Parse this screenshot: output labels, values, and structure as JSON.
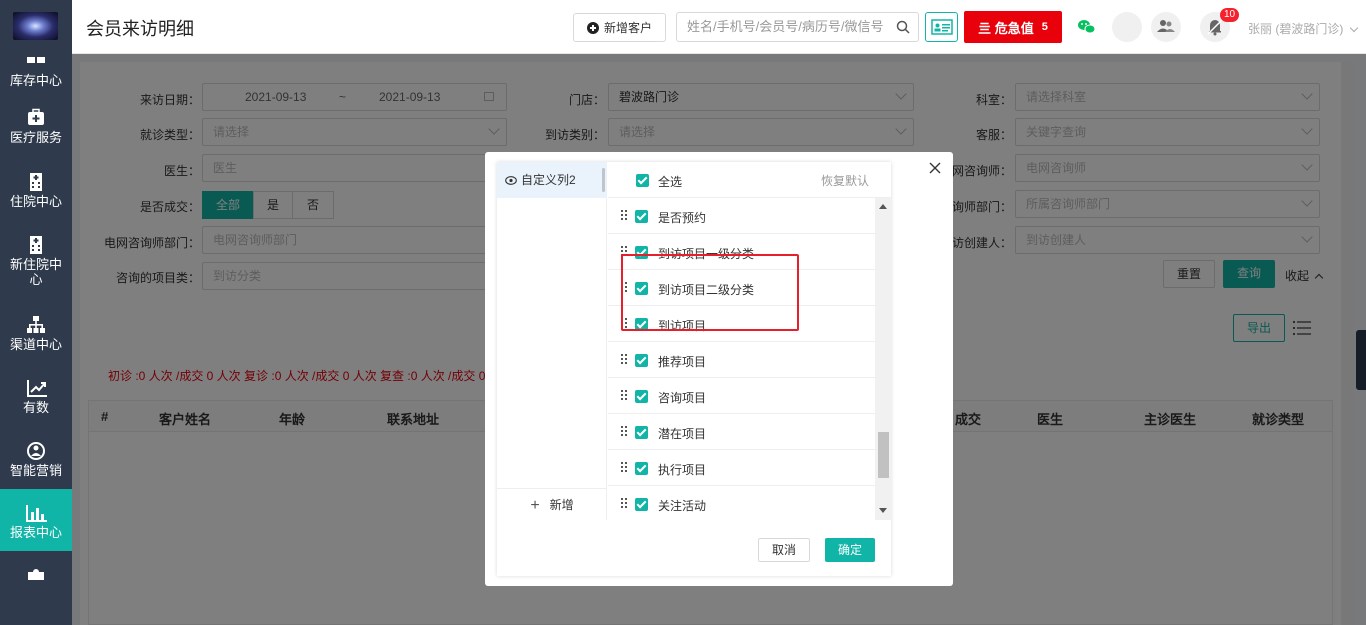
{
  "sidebar": {
    "items": [
      {
        "label": "库存中心",
        "icon": "inventory-icon"
      },
      {
        "label": "医疗服务",
        "icon": "medical-kit-icon"
      },
      {
        "label": "住院中心",
        "icon": "hospital-icon"
      },
      {
        "label": "新住院中心",
        "icon": "hospital-building-icon"
      },
      {
        "label": "渠道中心",
        "icon": "org-chart-icon"
      },
      {
        "label": "有数",
        "icon": "trend-chart-icon"
      },
      {
        "label": "智能营销",
        "icon": "marketing-icon"
      },
      {
        "label": "报表中心",
        "icon": "bar-chart-icon"
      }
    ]
  },
  "header": {
    "title": "会员来访明细",
    "new_customer": "新增客户",
    "search_placeholder": "姓名/手机号/会员号/病历号/微信号",
    "urgent_label": "危急值",
    "urgent_count": "5",
    "notif_count": "10",
    "user": "张丽 (碧波路门诊)"
  },
  "filters": {
    "visit_date_label": "来访日期：",
    "date_start": "2021-09-13",
    "date_sep": "~",
    "date_end": "2021-09-13",
    "store_label": "门店：",
    "store_value": "碧波路门诊",
    "dept_label": "科室：",
    "dept_placeholder": "请选择科室",
    "visit_type_label": "就诊类型：",
    "visit_type_placeholder": "请选择",
    "arrival_type_label": "到访类别：",
    "arrival_type_placeholder": "请选择",
    "cs_label": "客服：",
    "cs_placeholder": "关键字查询",
    "doctor_label": "医生：",
    "doctor_placeholder": "医生",
    "net_consultant_label": "网咨询师：",
    "net_consultant_placeholder": "电网咨询师",
    "deal_label": "是否成交：",
    "deal_all": "全部",
    "deal_yes": "是",
    "deal_no": "否",
    "consultant_dept_label": "询师部门：",
    "consultant_dept_placeholder": "所属咨询师部门",
    "net_consultant_dept_label": "电网咨询师部门：",
    "net_consultant_dept_placeholder": "电网咨询师部门",
    "creator_label": "访创建人：",
    "creator_placeholder": "到访创建人",
    "project_label": "咨询的项目类：",
    "project_placeholder": "到访分类",
    "reset": "重置",
    "query": "查询",
    "collapse": "收起",
    "export": "导出"
  },
  "stats": "初诊 :0 人次 /成交 0 人次   复诊 :0 人次 /成交 0 人次   复查 :0 人次 /成交 0",
  "table": {
    "columns": [
      "#",
      "客户姓名",
      "年龄",
      "联系地址",
      "成交",
      "医生",
      "主诊医生",
      "就诊类型"
    ]
  },
  "modal": {
    "view_name": "自定义列2",
    "add_label": "新增",
    "select_all": "全选",
    "restore_default": "恢复默认",
    "columns": [
      "是否预约",
      "到访项目一级分类",
      "到访项目二级分类",
      "到访项目",
      "推荐项目",
      "咨询项目",
      "潜在项目",
      "执行项目",
      "关注活动"
    ],
    "cancel": "取消",
    "confirm": "确定"
  },
  "colors": {
    "accent": "#11b5a7",
    "sidebar": "#2f3b4c",
    "danger": "#e8000b",
    "highlight_box": "#e5202a"
  }
}
